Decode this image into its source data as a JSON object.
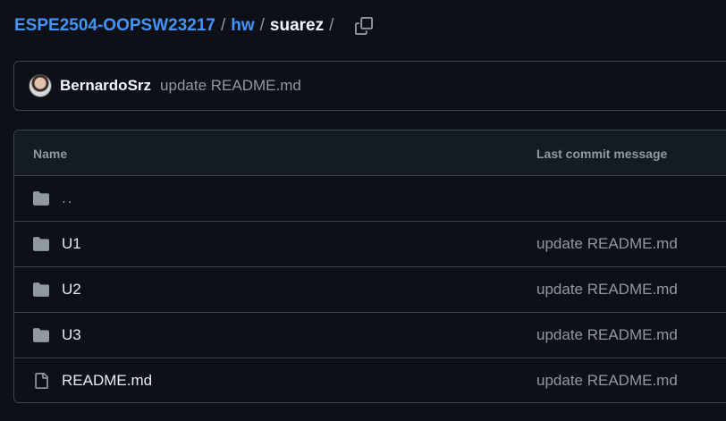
{
  "breadcrumb": {
    "repo": "ESPE2504-OOPSW23217",
    "sep1": "/",
    "folder": "hw",
    "sep2": "/",
    "current": "suarez",
    "sep3": "/"
  },
  "latest_commit": {
    "author": "BernardoSrz",
    "message": "update README.md"
  },
  "table": {
    "headers": {
      "name": "Name",
      "last_commit": "Last commit message"
    },
    "rows": [
      {
        "name": "..",
        "type": "parent-dir",
        "icon": "folder-icon",
        "message": ""
      },
      {
        "name": "U1",
        "type": "directory",
        "icon": "folder-icon",
        "message": "update README.md"
      },
      {
        "name": "U2",
        "type": "directory",
        "icon": "folder-icon",
        "message": "update README.md"
      },
      {
        "name": "U3",
        "type": "directory",
        "icon": "folder-icon",
        "message": "update README.md"
      },
      {
        "name": "README.md",
        "type": "file",
        "icon": "file-icon",
        "message": "update README.md"
      }
    ]
  },
  "colors": {
    "background": "#0d1117",
    "link": "#4493f8",
    "muted": "#9198a1",
    "border": "#3d444d"
  }
}
